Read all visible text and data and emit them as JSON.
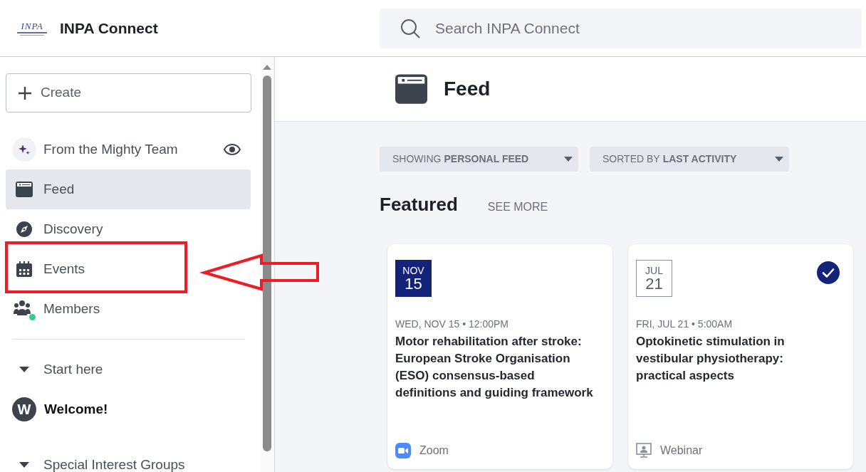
{
  "header": {
    "logo_text": "INPA",
    "title": "INPA Connect",
    "search": {
      "placeholder": "Search INPA Connect"
    }
  },
  "sidebar": {
    "create_button": "Create",
    "items": [
      {
        "kind": "mighty",
        "label": "From the Mighty Team",
        "selected": false
      },
      {
        "kind": "feed",
        "label": "Feed",
        "selected": true
      },
      {
        "kind": "discovery",
        "label": "Discovery",
        "selected": false
      },
      {
        "kind": "events",
        "label": "Events",
        "selected": false
      },
      {
        "kind": "members",
        "label": "Members",
        "selected": false,
        "online": true
      }
    ],
    "sections": [
      {
        "label": "Start here",
        "expanded": true,
        "children": [
          {
            "label": "Welcome!",
            "avatar_letter": "W"
          }
        ]
      },
      {
        "label": "Special Interest Groups",
        "expanded": true
      }
    ]
  },
  "main": {
    "title": "Feed",
    "filters": [
      {
        "prefix": "SHOWING",
        "value": "PERSONAL FEED"
      },
      {
        "prefix": "SORTED BY",
        "value": "LAST ACTIVITY"
      }
    ],
    "featured": {
      "heading": "Featured",
      "see_more": "SEE MORE",
      "events": [
        {
          "month": "NOV",
          "day": "15",
          "highlighted": true,
          "registered": false,
          "when": "WED, NOV 15 • 12:00PM",
          "title": "Motor rehabilitation after stroke: European Stroke Organisation (ESO) consensus-based definitions and guiding framework",
          "kind": "zoom",
          "platform": "Zoom"
        },
        {
          "month": "JUL",
          "day": "21",
          "highlighted": false,
          "registered": true,
          "when": "FRI, JUL 21 • 5:00AM",
          "title": "Optokinetic stimulation in vestibular physiotherapy: practical aspects",
          "kind": "webinar",
          "platform": "Webinar"
        }
      ]
    }
  }
}
